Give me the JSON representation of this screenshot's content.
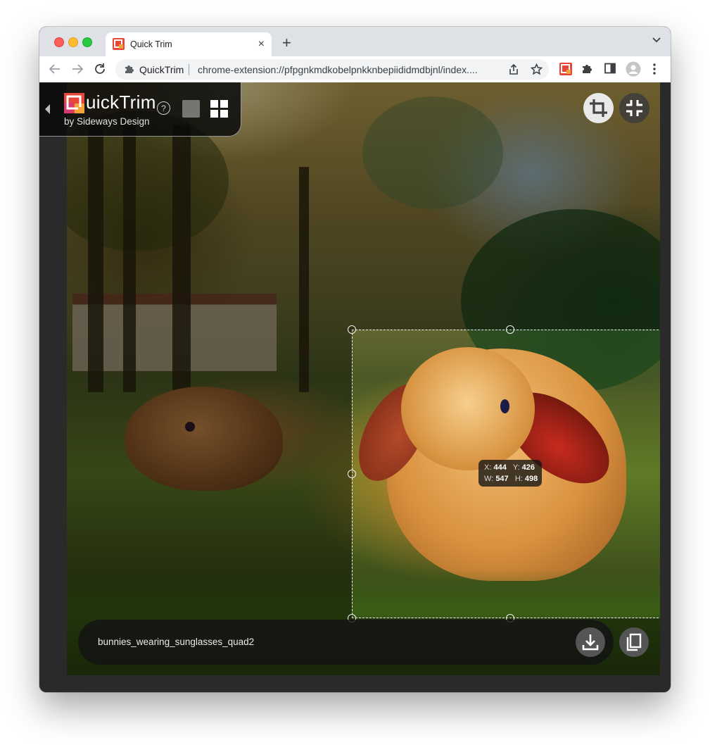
{
  "browser": {
    "tab_title": "Quick Trim",
    "new_tab_label": "+",
    "omnibox_ext_name": "QuickTrim",
    "url": "chrome-extension://pfpgnkmdkobelpnkknbepiididmdbjnl/index...."
  },
  "app": {
    "logo_text": "uickTrim",
    "logo_subtitle": "by Sideways Design",
    "help_label": "?",
    "swatch_color": "#777474",
    "brand_colors": [
      "#e8463a",
      "#f4a23a",
      "#d63a6e"
    ]
  },
  "crop": {
    "x_label": "X:",
    "x_value": "444",
    "y_label": "Y:",
    "y_value": "426",
    "w_label": "W:",
    "w_value": "547",
    "h_label": "H:",
    "h_value": "498"
  },
  "bottom_bar": {
    "filename": "bunnies_wearing_sunglasses_quad2"
  },
  "icons": {
    "toolbar": [
      "back-icon",
      "forward-icon",
      "reload-icon",
      "share-icon",
      "bookmark-star-icon",
      "quicktrim-extension-icon",
      "extensions-puzzle-icon",
      "side-panel-icon",
      "profile-avatar-icon",
      "more-menu-icon"
    ],
    "app": [
      "crop-icon",
      "collapse-icon",
      "download-icon",
      "copy-icon",
      "grid-icon",
      "help-icon"
    ]
  }
}
